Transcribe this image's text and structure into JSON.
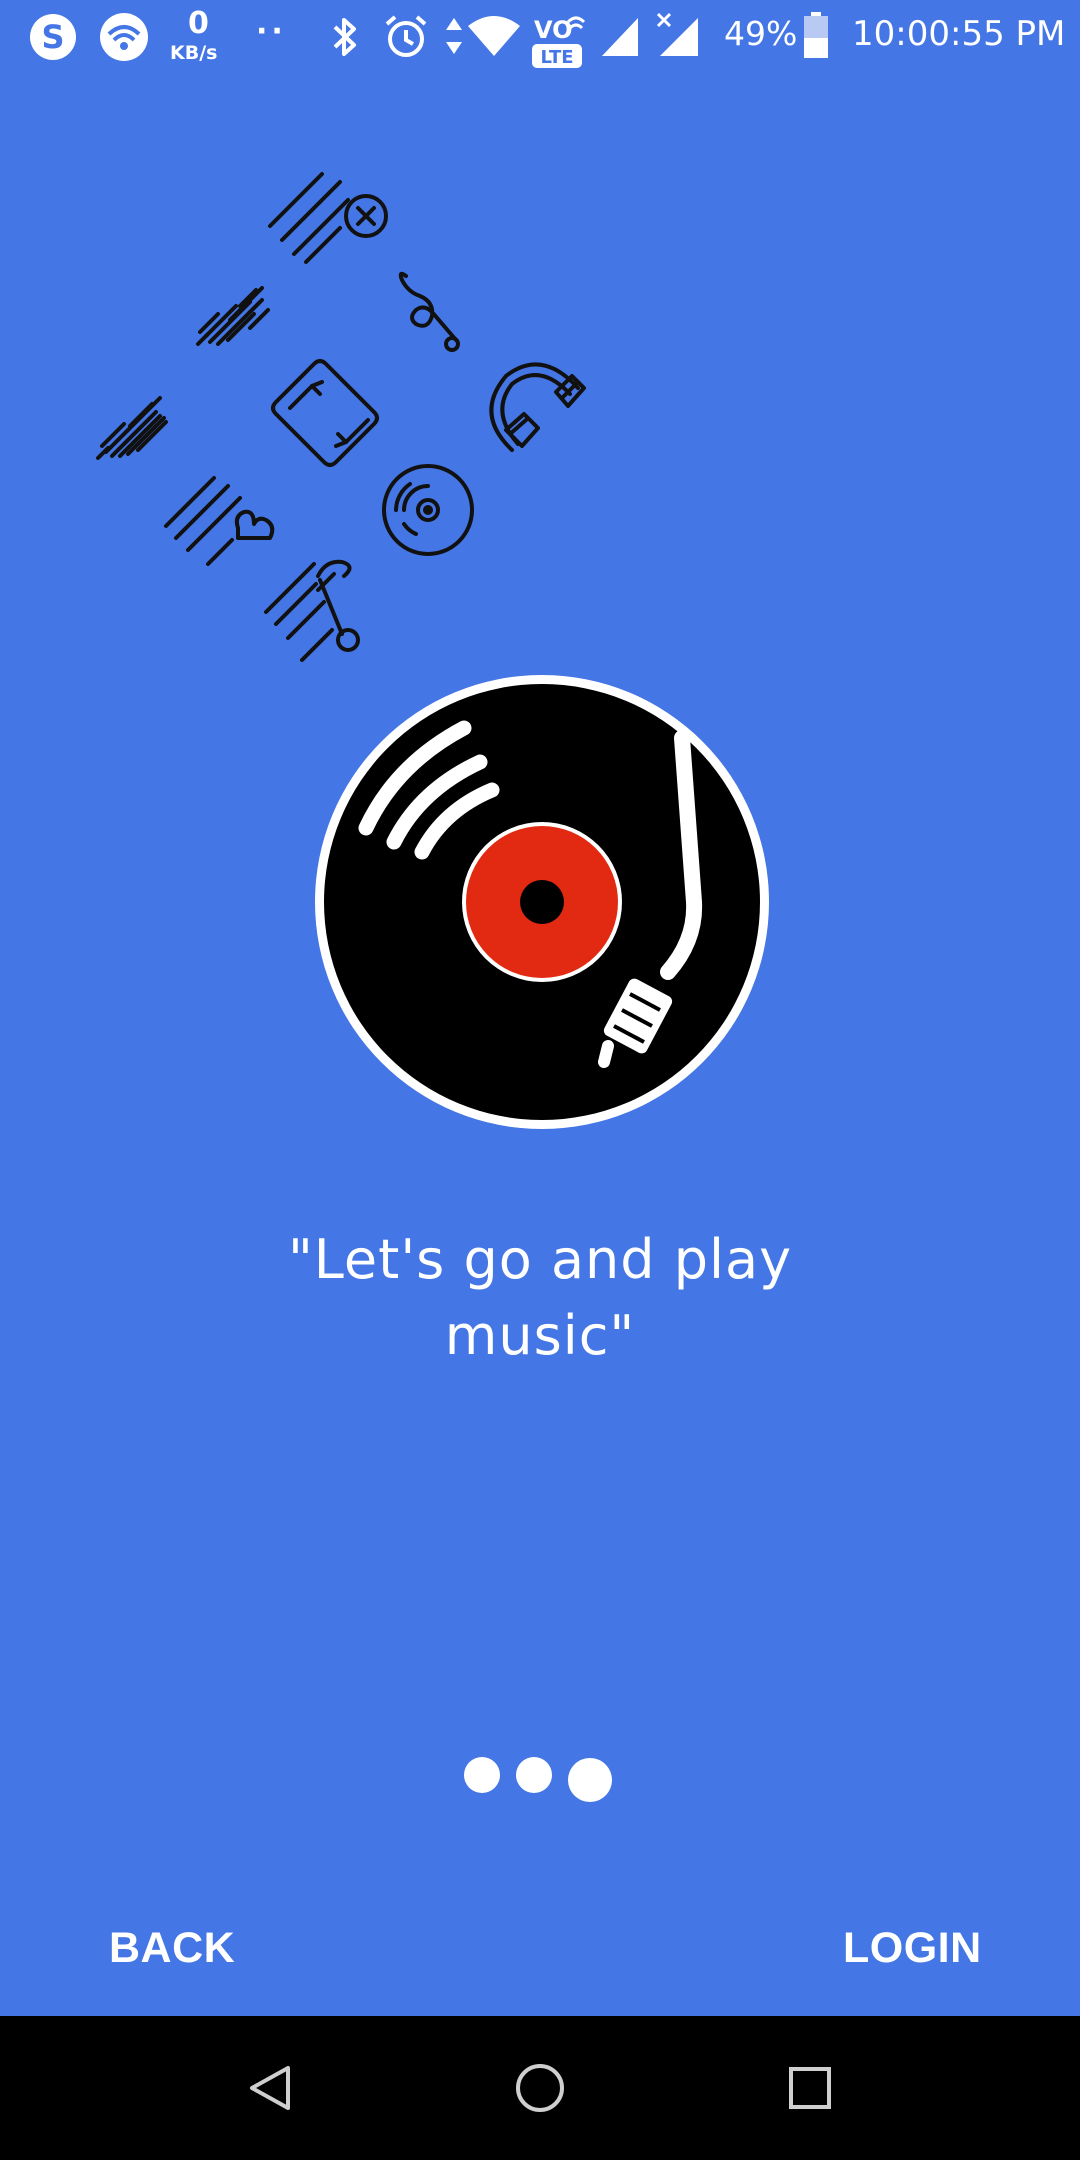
{
  "status_bar": {
    "network_speed_value": "0",
    "network_speed_unit": "KB/s",
    "notification_dots": "··",
    "volte_label_top": "VO",
    "volte_label_bottom": "LTE",
    "battery_percent": "49%",
    "time": "10:00:55 PM",
    "icons": [
      "skype-icon",
      "wifi-hotspot-icon",
      "bluetooth-icon",
      "alarm-icon",
      "data-arrows-icon",
      "wifi-icon",
      "volte-icon",
      "signal-icon",
      "signal-no-service-icon",
      "battery-icon"
    ]
  },
  "illustration": {
    "icons": [
      "playlist-remove-icon",
      "audio-wave-icon",
      "treble-clef-icon",
      "sound-wave-icon",
      "repeat-icon",
      "headphones-icon",
      "playlist-heart-icon",
      "cd-disc-icon",
      "playlist-music-icon",
      "vinyl-turntable-icon"
    ],
    "colors": {
      "background": "#4576E5",
      "record": "#000000",
      "label": "#E22A12",
      "outline": "#FFFFFF"
    }
  },
  "onboarding": {
    "quote": "\"Let's go and play music\"",
    "pager": {
      "total": 3,
      "current": 3
    }
  },
  "actions": {
    "back_label": "BACK",
    "login_label": "LOGIN"
  },
  "system_nav": {
    "icons": [
      "back-triangle-icon",
      "home-circle-icon",
      "recents-square-icon"
    ]
  }
}
